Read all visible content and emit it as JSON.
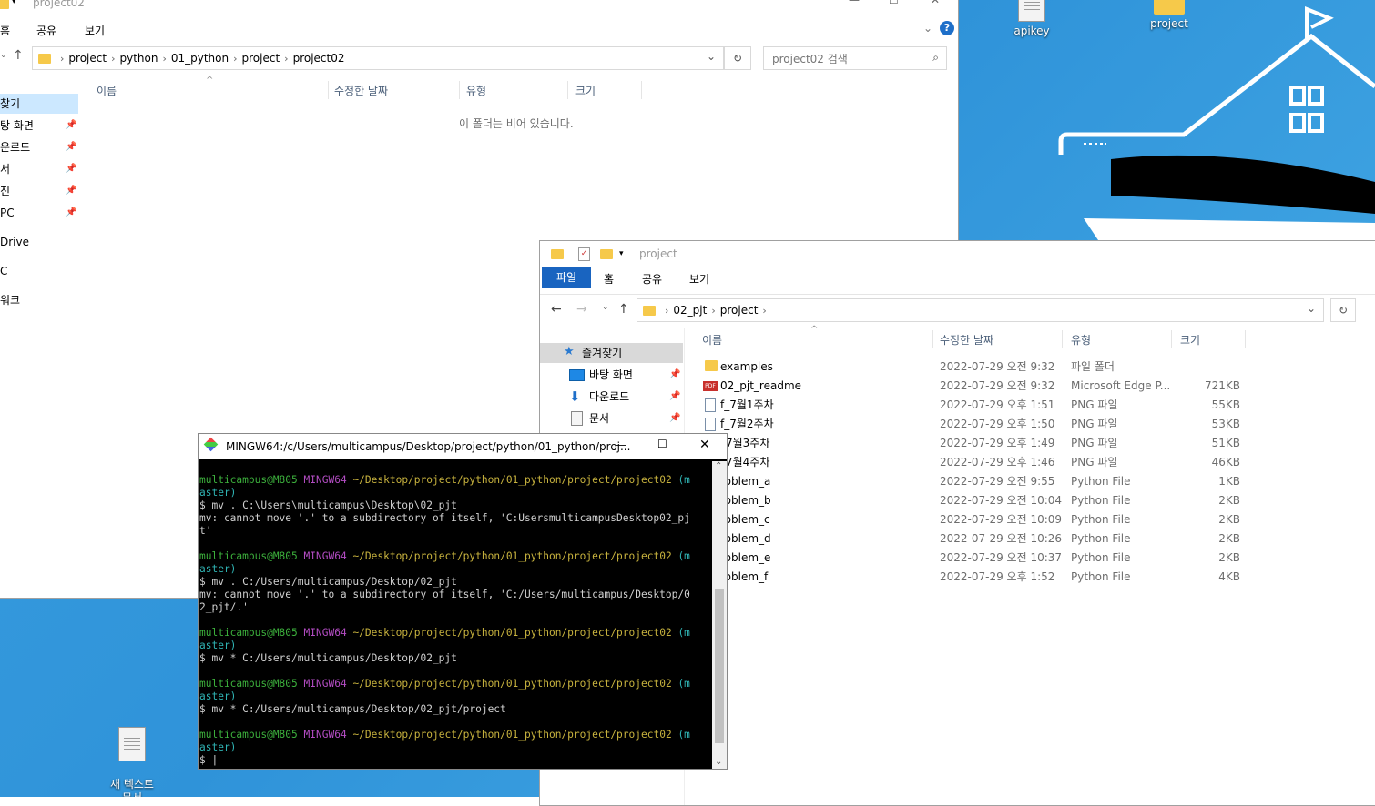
{
  "desktop": {
    "icons": [
      {
        "label": "apikey"
      },
      {
        "label": "project"
      },
      {
        "label": "새 텍스트\n문서"
      }
    ]
  },
  "win1": {
    "title": "project02",
    "tabs": [
      "홈",
      "공유",
      "보기"
    ],
    "breadcrumb": [
      "project",
      "python",
      "01_python",
      "project",
      "project02"
    ],
    "search_placeholder": "project02 검색",
    "columns": [
      "이름",
      "수정한 날짜",
      "유형",
      "크기"
    ],
    "empty_text": "이 폴더는 비어 있습니다.",
    "nav": [
      "찾기",
      "탕 화면",
      "운로드",
      "서",
      "진",
      "PC",
      "Drive",
      "C",
      "워크"
    ]
  },
  "win2": {
    "title": "project",
    "tabs": [
      "파일",
      "홈",
      "공유",
      "보기"
    ],
    "breadcrumb": [
      "02_pjt",
      "project"
    ],
    "columns": [
      "이름",
      "수정한 날짜",
      "유형",
      "크기"
    ],
    "nav": [
      {
        "label": "즐겨찾기"
      },
      {
        "label": "바탕 화면"
      },
      {
        "label": "다운로드"
      },
      {
        "label": "문서"
      }
    ],
    "files": [
      {
        "name": "examples",
        "date": "2022-07-29 오전 9:32",
        "type": "파일 폴더",
        "size": "",
        "icon": "folder-icon"
      },
      {
        "name": "02_pjt_readme",
        "date": "2022-07-29 오전 9:32",
        "type": "Microsoft Edge P...",
        "size": "721KB",
        "icon": "pdf-icon"
      },
      {
        "name": "f_7월1주차",
        "date": "2022-07-29 오후 1:51",
        "type": "PNG 파일",
        "size": "55KB",
        "icon": "image-file-icon"
      },
      {
        "name": "f_7월2주차",
        "date": "2022-07-29 오후 1:50",
        "type": "PNG 파일",
        "size": "53KB",
        "icon": "image-file-icon"
      },
      {
        "name": "_7월3주차",
        "date": "2022-07-29 오후 1:49",
        "type": "PNG 파일",
        "size": "51KB",
        "icon": "image-file-icon"
      },
      {
        "name": "_7월4주차",
        "date": "2022-07-29 오후 1:46",
        "type": "PNG 파일",
        "size": "46KB",
        "icon": "image-file-icon"
      },
      {
        "name": "roblem_a",
        "date": "2022-07-29 오전 9:55",
        "type": "Python File",
        "size": "1KB",
        "icon": "python-file-icon"
      },
      {
        "name": "roblem_b",
        "date": "2022-07-29 오전 10:04",
        "type": "Python File",
        "size": "2KB",
        "icon": "python-file-icon"
      },
      {
        "name": "roblem_c",
        "date": "2022-07-29 오전 10:09",
        "type": "Python File",
        "size": "2KB",
        "icon": "python-file-icon"
      },
      {
        "name": "roblem_d",
        "date": "2022-07-29 오전 10:26",
        "type": "Python File",
        "size": "2KB",
        "icon": "python-file-icon"
      },
      {
        "name": "roblem_e",
        "date": "2022-07-29 오전 10:37",
        "type": "Python File",
        "size": "2KB",
        "icon": "python-file-icon"
      },
      {
        "name": "roblem_f",
        "date": "2022-07-29 오후 1:52",
        "type": "Python File",
        "size": "4KB",
        "icon": "python-file-icon"
      }
    ]
  },
  "terminal": {
    "title": "MINGW64:/c/Users/multicampus/Desktop/project/python/01_python/proj...",
    "lines": [
      {
        "kind": "blank",
        "text": ""
      },
      {
        "kind": "prompt",
        "user": "multicampus@M805",
        "sys": "MINGW64",
        "path": "~/Desktop/project/python/01_python/project/project02",
        "branch": "(m"
      },
      {
        "kind": "branch2",
        "text": "aster)"
      },
      {
        "kind": "plain",
        "text": "$ mv . C:\\Users\\multicampus\\Desktop\\02_pjt"
      },
      {
        "kind": "plain",
        "text": "mv: cannot move '.' to a subdirectory of itself, 'C:UsersmulticampusDesktop02_pj"
      },
      {
        "kind": "plain",
        "text": "t'"
      },
      {
        "kind": "blank",
        "text": ""
      },
      {
        "kind": "prompt",
        "user": "multicampus@M805",
        "sys": "MINGW64",
        "path": "~/Desktop/project/python/01_python/project/project02",
        "branch": "(m"
      },
      {
        "kind": "branch2",
        "text": "aster)"
      },
      {
        "kind": "plain",
        "text": "$ mv . C:/Users/multicampus/Desktop/02_pjt"
      },
      {
        "kind": "plain",
        "text": "mv: cannot move '.' to a subdirectory of itself, 'C:/Users/multicampus/Desktop/0"
      },
      {
        "kind": "plain",
        "text": "2_pjt/.'"
      },
      {
        "kind": "blank",
        "text": ""
      },
      {
        "kind": "prompt",
        "user": "multicampus@M805",
        "sys": "MINGW64",
        "path": "~/Desktop/project/python/01_python/project/project02",
        "branch": "(m"
      },
      {
        "kind": "branch2",
        "text": "aster)"
      },
      {
        "kind": "plain",
        "text": "$ mv * C:/Users/multicampus/Desktop/02_pjt"
      },
      {
        "kind": "blank",
        "text": ""
      },
      {
        "kind": "prompt",
        "user": "multicampus@M805",
        "sys": "MINGW64",
        "path": "~/Desktop/project/python/01_python/project/project02",
        "branch": "(m"
      },
      {
        "kind": "branch2",
        "text": "aster)"
      },
      {
        "kind": "plain",
        "text": "$ mv * C:/Users/multicampus/Desktop/02_pjt/project"
      },
      {
        "kind": "blank",
        "text": ""
      },
      {
        "kind": "prompt",
        "user": "multicampus@M805",
        "sys": "MINGW64",
        "path": "~/Desktop/project/python/01_python/project/project02",
        "branch": "(m"
      },
      {
        "kind": "branch2",
        "text": "aster)"
      },
      {
        "kind": "plain",
        "text": "$ |"
      }
    ]
  }
}
